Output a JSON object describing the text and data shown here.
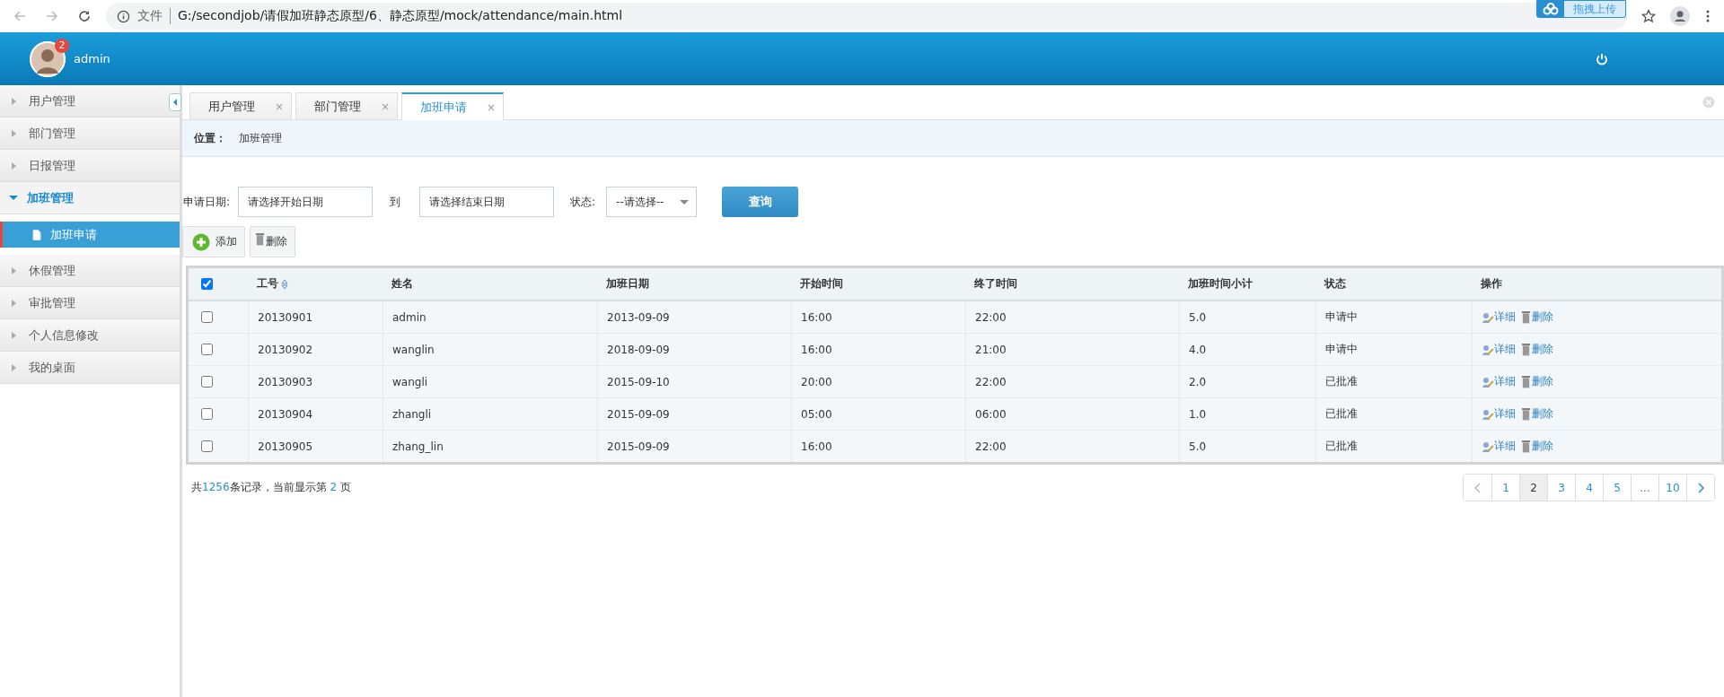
{
  "browser": {
    "security_label": "文件",
    "url": "G:/secondjob/请假加班静态原型/6、静态原型/mock/attendance/main.html",
    "extension_label": "拖拽上传"
  },
  "header": {
    "user": "admin",
    "badge": "2"
  },
  "sidebar": {
    "items": [
      {
        "label": "用户管理",
        "expanded": false
      },
      {
        "label": "部门管理",
        "expanded": false
      },
      {
        "label": "日报管理",
        "expanded": false
      },
      {
        "label": "加班管理",
        "expanded": true,
        "children": [
          {
            "label": "加班申请",
            "selected": true
          }
        ]
      },
      {
        "label": "休假管理",
        "expanded": false
      },
      {
        "label": "审批管理",
        "expanded": false
      },
      {
        "label": "个人信息修改",
        "expanded": false
      },
      {
        "label": "我的桌面",
        "expanded": false
      }
    ]
  },
  "tabs": [
    {
      "label": "用户管理",
      "selected": false,
      "close": "×"
    },
    {
      "label": "部门管理",
      "selected": false,
      "close": "×"
    },
    {
      "label": "加班申请",
      "selected": true,
      "close": "×"
    }
  ],
  "breadcrumb": {
    "label": "位置：",
    "value": "加班管理"
  },
  "filters": {
    "date_label": "申请日期:",
    "start_placeholder": "请选择开始日期",
    "to_label": "到",
    "end_placeholder": "请选择结束日期",
    "status_label": "状态:",
    "status_value": "--请选择--",
    "search_button": "查询"
  },
  "toolbar": {
    "add": "添加",
    "delete": "删除"
  },
  "table": {
    "all_checked": true,
    "columns": [
      {
        "label": "工号",
        "sortable": true
      },
      {
        "label": "姓名",
        "sortable": false
      },
      {
        "label": "加班日期",
        "sortable": false
      },
      {
        "label": "开始时间",
        "sortable": false
      },
      {
        "label": "终了时间",
        "sortable": false
      },
      {
        "label": "加班时间小计",
        "sortable": false
      },
      {
        "label": "状态",
        "sortable": false
      },
      {
        "label": "操作",
        "sortable": false
      }
    ],
    "rows": [
      {
        "checked": false,
        "cells": [
          "20130901",
          "admin",
          "2013-09-09",
          "16:00",
          "22:00",
          "5.0",
          "申请中"
        ],
        "actions": [
          "详细",
          "删除"
        ]
      },
      {
        "checked": false,
        "cells": [
          "20130902",
          "wanglin",
          "2018-09-09",
          "16:00",
          "21:00",
          "4.0",
          "申请中"
        ],
        "actions": [
          "详细",
          "删除"
        ]
      },
      {
        "checked": false,
        "cells": [
          "20130903",
          "wangli",
          "2015-09-10",
          "20:00",
          "22:00",
          "2.0",
          "已批准"
        ],
        "actions": [
          "详细",
          "删除"
        ]
      },
      {
        "checked": false,
        "cells": [
          "20130904",
          "zhangli",
          "2015-09-09",
          "05:00",
          "06:00",
          "1.0",
          "已批准"
        ],
        "actions": [
          "详细",
          "删除"
        ]
      },
      {
        "checked": false,
        "cells": [
          "20130905",
          "zhang_lin",
          "2015-09-09",
          "16:00",
          "22:00",
          "5.0",
          "已批准"
        ],
        "actions": [
          "详细",
          "删除"
        ]
      }
    ]
  },
  "footer": {
    "prefix": "共",
    "total": "1256",
    "middle": "条记录，当前显示第 ",
    "page": "2",
    "suffix": " 页"
  },
  "pagination": [
    {
      "kind": "prev"
    },
    {
      "kind": "page",
      "label": "1",
      "selected": false
    },
    {
      "kind": "page",
      "label": "2",
      "selected": true
    },
    {
      "kind": "page",
      "label": "3",
      "selected": false
    },
    {
      "kind": "page",
      "label": "4",
      "selected": false
    },
    {
      "kind": "page",
      "label": "5",
      "selected": false
    },
    {
      "kind": "ellipsis",
      "label": "..."
    },
    {
      "kind": "page",
      "label": "10",
      "selected": false
    },
    {
      "kind": "next"
    }
  ]
}
